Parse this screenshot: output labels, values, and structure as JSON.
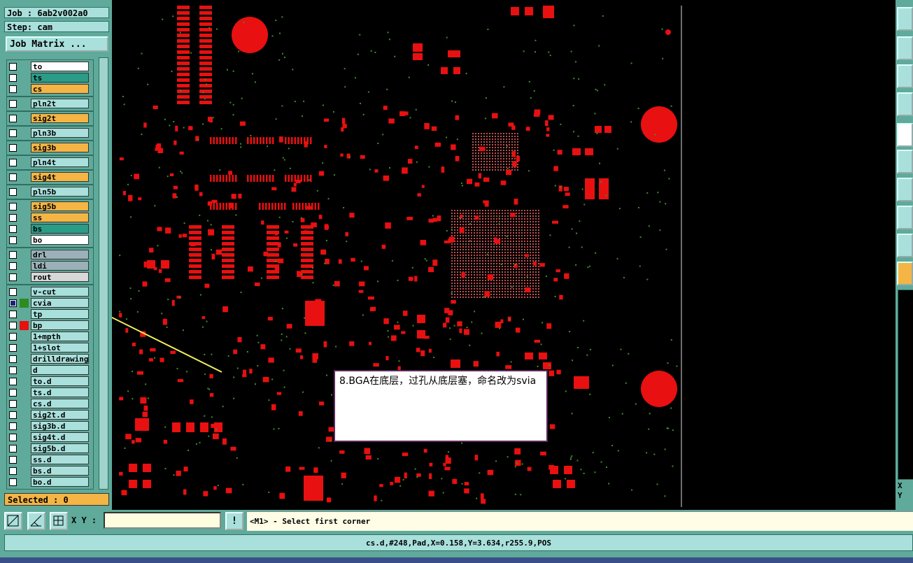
{
  "header": {
    "job": "Job : 6ab2v002a0",
    "step": "Step: cam",
    "job_matrix_label": "Job Matrix ..."
  },
  "layers": [
    {
      "name": "to",
      "color": "#ffffff",
      "swatch": ""
    },
    {
      "name": "ts",
      "color": "#2a9c88",
      "swatch": ""
    },
    {
      "name": "cs",
      "color": "#f4b545",
      "swatch": ""
    },
    {
      "name": "pln2t",
      "color": "#a9e0dc",
      "swatch": ""
    },
    {
      "name": "sig2t",
      "color": "#f4b545",
      "swatch": ""
    },
    {
      "name": "pln3b",
      "color": "#a9e0dc",
      "swatch": ""
    },
    {
      "name": "sig3b",
      "color": "#f4b545",
      "swatch": ""
    },
    {
      "name": "pln4t",
      "color": "#a9e0dc",
      "swatch": ""
    },
    {
      "name": "sig4t",
      "color": "#f4b545",
      "swatch": ""
    },
    {
      "name": "pln5b",
      "color": "#a9e0dc",
      "swatch": ""
    },
    {
      "name": "sig5b",
      "color": "#f4b545",
      "swatch": ""
    },
    {
      "name": "ss",
      "color": "#f4b545",
      "swatch": ""
    },
    {
      "name": "bs",
      "color": "#2a9c88",
      "swatch": ""
    },
    {
      "name": "bo",
      "color": "#ffffff",
      "swatch": ""
    },
    {
      "name": "drl",
      "color": "#9bb0b8",
      "swatch": ""
    },
    {
      "name": "ldi",
      "color": "#9bb0b8",
      "swatch": ""
    },
    {
      "name": "rout",
      "color": "#d8d8d8",
      "swatch": ""
    },
    {
      "name": "v-cut",
      "color": "#a9e0dc",
      "swatch": ""
    },
    {
      "name": "cvia",
      "color": "#a9e0dc",
      "swatch": "#2e8b22"
    },
    {
      "name": "tp",
      "color": "#a9e0dc",
      "swatch": ""
    },
    {
      "name": "bp",
      "color": "#a9e0dc",
      "swatch": "#e81010"
    },
    {
      "name": "1+mpth",
      "color": "#a9e0dc",
      "swatch": ""
    },
    {
      "name": "1+slot",
      "color": "#a9e0dc",
      "swatch": ""
    },
    {
      "name": "drilldrawing",
      "color": "#a9e0dc",
      "swatch": ""
    },
    {
      "name": "d",
      "color": "#a9e0dc",
      "swatch": ""
    },
    {
      "name": "to.d",
      "color": "#a9e0dc",
      "swatch": ""
    },
    {
      "name": "ts.d",
      "color": "#a9e0dc",
      "swatch": ""
    },
    {
      "name": "cs.d",
      "color": "#a9e0dc",
      "swatch": ""
    },
    {
      "name": "sig2t.d",
      "color": "#a9e0dc",
      "swatch": ""
    },
    {
      "name": "sig3b.d",
      "color": "#a9e0dc",
      "swatch": ""
    },
    {
      "name": "sig4t.d",
      "color": "#a9e0dc",
      "swatch": ""
    },
    {
      "name": "sig5b.d",
      "color": "#a9e0dc",
      "swatch": ""
    },
    {
      "name": "ss.d",
      "color": "#a9e0dc",
      "swatch": ""
    },
    {
      "name": "bs.d",
      "color": "#a9e0dc",
      "swatch": ""
    },
    {
      "name": "bo.d",
      "color": "#a9e0dc",
      "swatch": ""
    }
  ],
  "selected": "Selected : 0",
  "xy_label": "X Y :",
  "xy_value": "",
  "prompt_button": "!",
  "message": "<M1> - Select first corner",
  "status": "cs.d,#248,Pad,X=0.158,Y=3.634,r255.9,POS",
  "callout": "8.BGA在底层，过孔从底层塞，命名改为svia",
  "right_coords": [
    "X",
    "Y"
  ],
  "colors": {
    "pad": "#e81010",
    "via": "#3f8f2f",
    "background": "#000000"
  }
}
